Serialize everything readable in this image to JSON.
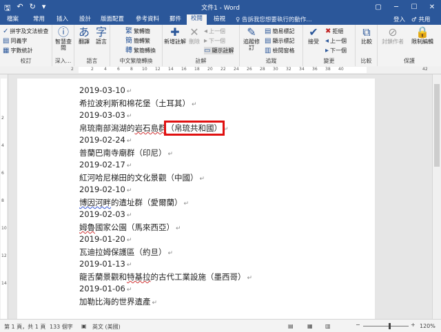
{
  "titlebar": {
    "title": "文件1 - Word",
    "qat": {
      "save": "🖫",
      "undo": "↶",
      "redo": "↻",
      "customize": "▾"
    },
    "buttons": {
      "ribbon_display": "▢",
      "minimize": "─",
      "maximize": "☐",
      "close": "✕"
    }
  },
  "tabs": [
    {
      "label": "檔案"
    },
    {
      "label": "常用"
    },
    {
      "label": "插入"
    },
    {
      "label": "設計"
    },
    {
      "label": "版面配置"
    },
    {
      "label": "參考資料"
    },
    {
      "label": "郵件"
    },
    {
      "label": "校閱"
    },
    {
      "label": "檢視"
    }
  ],
  "tellme": "♀ 告訴我您想要執行的動作...",
  "signin": "登入",
  "share": "♂ 共用",
  "ribbon": {
    "proofing": {
      "label": "校訂",
      "spell": "拼字及文法檢查",
      "thesaurus": "同義字",
      "wordcount": "字數統計"
    },
    "insights": {
      "label": "深入...",
      "smart_lookup": "智慧查閱"
    },
    "language": {
      "label": "語言",
      "translate": "翻譯",
      "language": "語言"
    },
    "chinese": {
      "label": "中文繁簡轉換",
      "to_trad": "繁轉簡",
      "to_simp": "簡轉繁",
      "convert": "繁簡轉換"
    },
    "comments": {
      "label": "註解",
      "new": "新增註解",
      "delete": "刪除",
      "previous": "上一個",
      "next": "下一個",
      "show": "顯示註解"
    },
    "tracking": {
      "label": "追蹤",
      "track": "追蹤修訂",
      "markup": "簡易標記",
      "show_markup": "顯示標記",
      "pane": "檢閱窗格"
    },
    "changes": {
      "label": "變更",
      "accept": "接受",
      "reject": "拒絕",
      "previous": "上一個",
      "next": "下一個"
    },
    "compare": {
      "label": "比較",
      "compare": "比較"
    },
    "protect": {
      "label": "保護",
      "block_authors": "封鎖作者",
      "restrict": "限制編輯"
    }
  },
  "ruler": {
    "h_marks": [
      "2",
      "2",
      "4",
      "6",
      "8",
      "10",
      "12",
      "14",
      "16",
      "18",
      "20",
      "22",
      "24",
      "26",
      "28",
      "30",
      "32",
      "34",
      "36",
      "38",
      "40",
      "42"
    ],
    "v_marks": [
      "2",
      "4",
      "6",
      "8",
      "10",
      "12",
      "14"
    ]
  },
  "document": {
    "lines": [
      {
        "text": "2019-03-10",
        "mark": "↵"
      },
      {
        "text": "希拉波利斯和棉花堡（土耳其）",
        "mark": "↵"
      },
      {
        "text": "2019-03-03",
        "mark": "↵"
      },
      {
        "before": "帛琉南部潟湖的",
        "squig": "岩石島群",
        "highlight": "（帛琉共和國）",
        "mark": "↵"
      },
      {
        "text": "2019-02-24",
        "mark": "↵"
      },
      {
        "text": "普蘭巴南寺廟群（印尼）",
        "mark": "↵"
      },
      {
        "text": "2019-02-17",
        "mark": "↵"
      },
      {
        "text": "紅河哈尼梯田的文化景觀（中國）",
        "mark": "↵"
      },
      {
        "text": "2019-02-10",
        "mark": "↵"
      },
      {
        "squig": "博因河畔",
        "after": "的遺址群（愛爾蘭）",
        "mark": "↵"
      },
      {
        "text": "2019-02-03",
        "mark": "↵"
      },
      {
        "squig": "姆魯",
        "after": "國家公園（馬來西亞）",
        "mark": "↵"
      },
      {
        "text": "2019-01-20",
        "mark": "↵"
      },
      {
        "text": "瓦迪拉姆保護區（約旦）",
        "mark": "↵"
      },
      {
        "text": "2019-01-13",
        "mark": "↵"
      },
      {
        "before": "龍舌蘭景觀和",
        "squig": "特基拉",
        "after": "的古代工業設施（墨西哥）",
        "mark": "↵"
      },
      {
        "text": "2019-01-06",
        "mark": "↵"
      },
      {
        "text": "加勒比海的世界遺產",
        "mark": "↵"
      }
    ]
  },
  "status": {
    "page": "第 1 頁，共 1 頁",
    "words": "133 個字",
    "lang": "英文 (美國)",
    "zoom": "120%",
    "zoom_out": "−",
    "zoom_in": "+"
  }
}
